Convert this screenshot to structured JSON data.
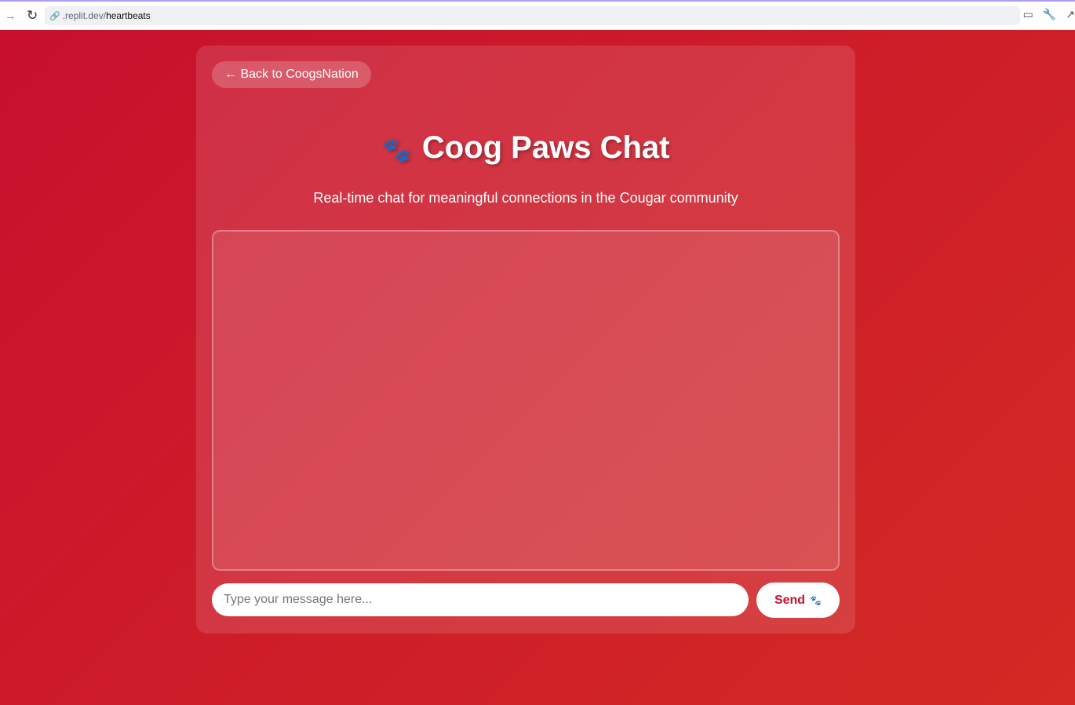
{
  "browser": {
    "url_host": ".replit.dev/",
    "url_path": "heartbeats"
  },
  "card": {
    "back_label": "← Back to CoogsNation",
    "title": "Coog Paws Chat",
    "title_icon": "🐾",
    "subtitle": "Real-time chat for meaningful connections in the Cougar community"
  },
  "composer": {
    "placeholder": "Type your message here...",
    "send_label": "Send",
    "send_icon": "🐾"
  },
  "colors": {
    "brand": "#c8102e"
  }
}
